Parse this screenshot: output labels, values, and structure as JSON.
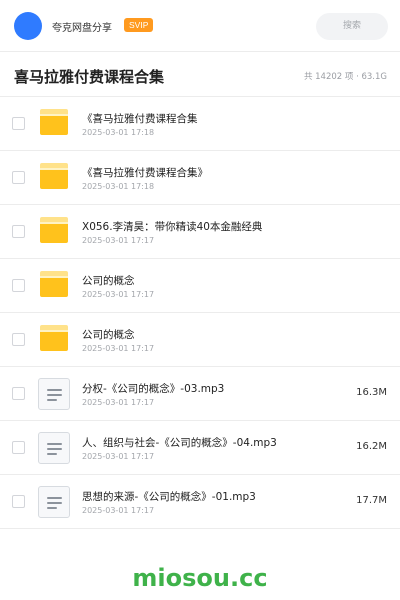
{
  "header": {
    "user_name": "夸克网盘分享",
    "vip_label": "SVIP",
    "search_placeholder": "搜索",
    "avatar_color": "#2f7bff",
    "vip_color": "#ff9a1f"
  },
  "title_bar": {
    "title": "喜马拉雅付费课程合集",
    "stats": "共 14202 项 · 63.1G"
  },
  "files": [
    {
      "type": "folder",
      "icon": "folder-icon",
      "name": "《喜马拉雅付费课程合集",
      "date": "2025-03-01 17:18",
      "size": ""
    },
    {
      "type": "folder",
      "icon": "folder-icon",
      "name": "《喜马拉雅付费课程合集》",
      "date": "2025-03-01 17:18",
      "size": ""
    },
    {
      "type": "folder",
      "icon": "folder-icon",
      "name": "X056.李清昊：带你精读40本金融经典",
      "date": "2025-03-01 17:17",
      "size": ""
    },
    {
      "type": "folder",
      "icon": "folder-icon",
      "name": "公司的概念",
      "date": "2025-03-01 17:17",
      "size": ""
    },
    {
      "type": "folder",
      "icon": "folder-icon",
      "name": "公司的概念",
      "date": "2025-03-01 17:17",
      "size": ""
    },
    {
      "type": "file",
      "icon": "document-icon",
      "name": "分权-《公司的概念》-03.mp3",
      "date": "2025-03-01 17:17",
      "size": "16.3M"
    },
    {
      "type": "file",
      "icon": "document-icon",
      "name": "人、组织与社会-《公司的概念》-04.mp3",
      "date": "2025-03-01 17:17",
      "size": "16.2M"
    },
    {
      "type": "file",
      "icon": "document-icon",
      "name": "思想的来源-《公司的概念》-01.mp3",
      "date": "2025-03-01 17:17",
      "size": "17.7M"
    }
  ],
  "footer": {
    "watermark": "miosou.cc",
    "watermark_color": "#3fb24a"
  }
}
